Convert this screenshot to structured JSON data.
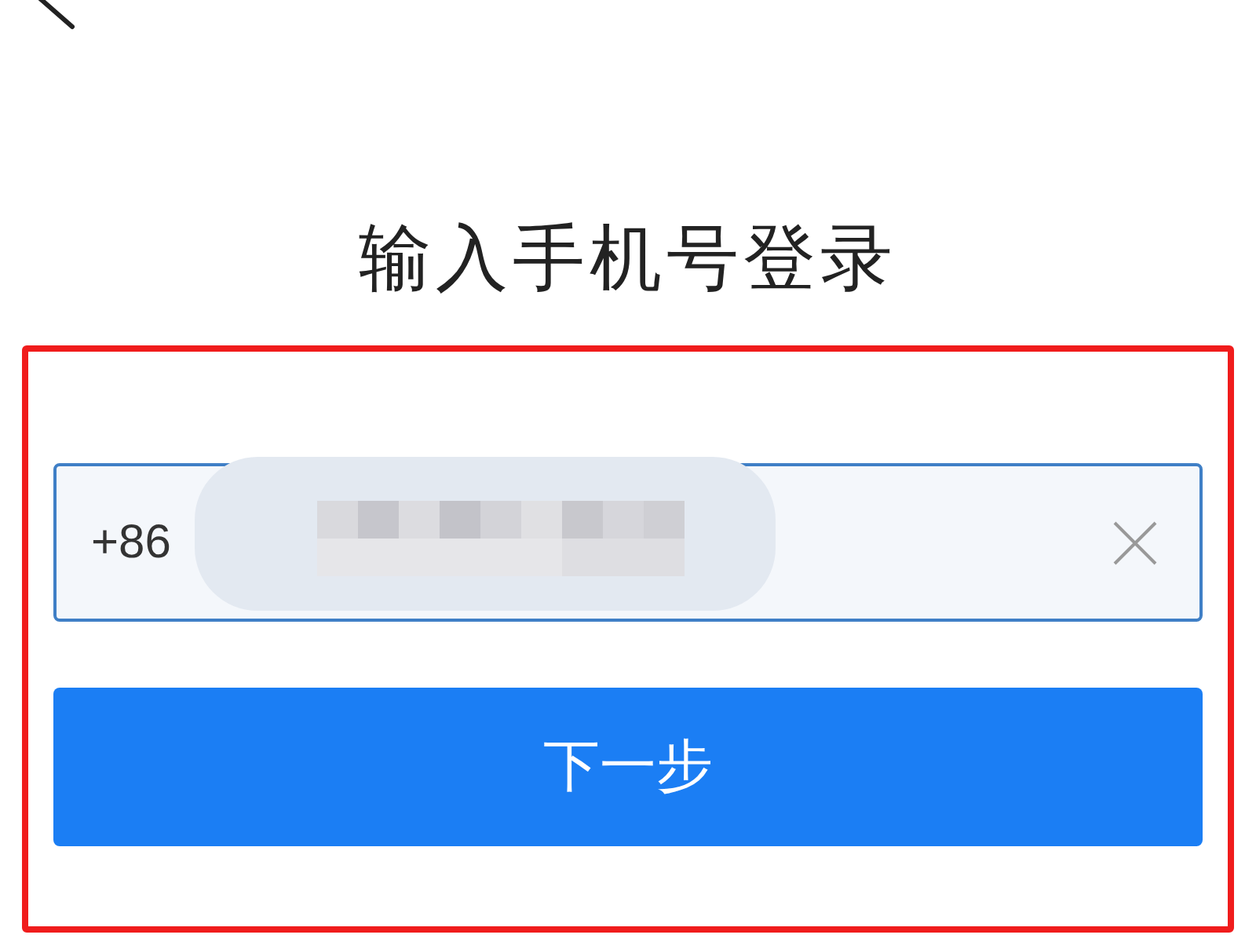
{
  "title": "输入手机号登录",
  "highlight": true,
  "phone_field": {
    "prefix": "+86",
    "masked": true
  },
  "next_button": {
    "label": "下一步"
  }
}
